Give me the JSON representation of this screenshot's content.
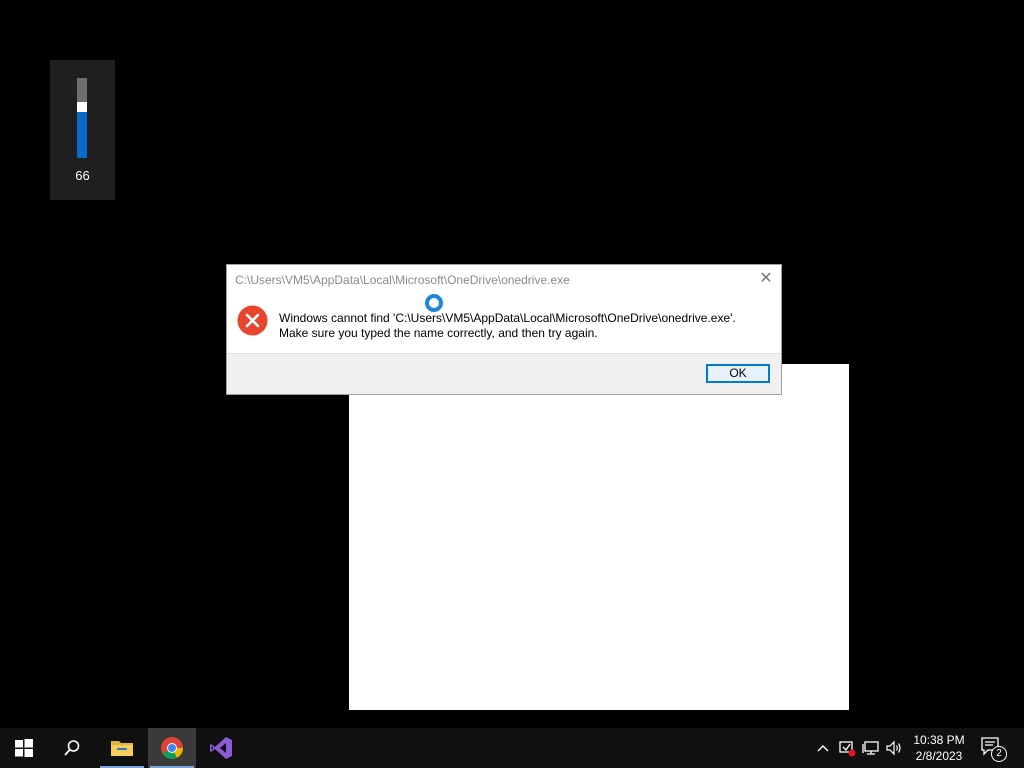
{
  "volume": {
    "value": "66",
    "level_percent": 66
  },
  "dialog": {
    "title": "C:\\Users\\VM5\\AppData\\Local\\Microsoft\\OneDrive\\onedrive.exe",
    "message_line1": "Windows cannot find 'C:\\Users\\VM5\\AppData\\Local\\Microsoft\\OneDrive\\onedrive.exe'.",
    "message_line2": "Make sure you typed the name correctly, and then try again.",
    "ok_label": "OK",
    "close_glyph": "✕"
  },
  "taskbar": {
    "apps": [
      {
        "name": "start",
        "icon": "windows-logo-icon"
      },
      {
        "name": "search",
        "icon": "search-icon"
      },
      {
        "name": "file-explorer",
        "icon": "folder-icon"
      },
      {
        "name": "chrome",
        "icon": "chrome-icon",
        "active": true
      },
      {
        "name": "visual-studio",
        "icon": "visual-studio-icon"
      }
    ],
    "clock": {
      "time": "10:38 PM",
      "date": "2/8/2023"
    },
    "notification_count": "2"
  },
  "colors": {
    "accent": "#0078d7",
    "error_red": "#e81123",
    "volume_fill": "#0a6ac9"
  }
}
